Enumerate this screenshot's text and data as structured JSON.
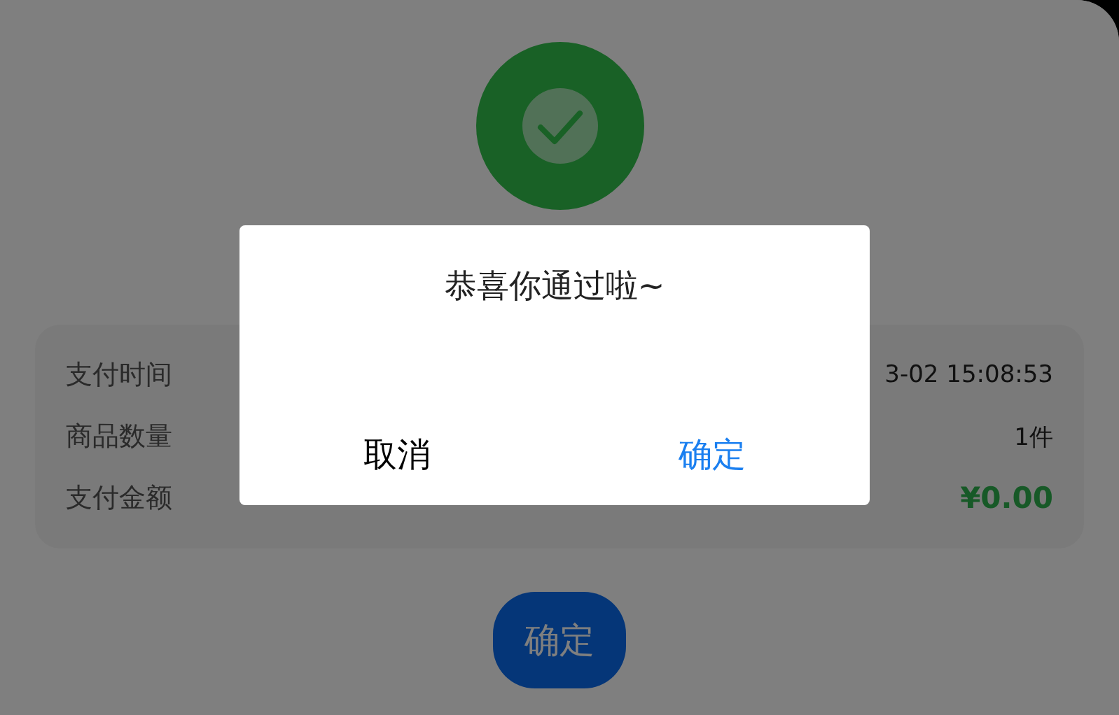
{
  "status": {
    "kind": "success"
  },
  "details": [
    {
      "label": "支付时间",
      "value": "3-02 15:08:53",
      "kind": "text"
    },
    {
      "label": "商品数量",
      "value": "1件",
      "kind": "text"
    },
    {
      "label": "支付金额",
      "value": "¥0.00",
      "kind": "price"
    }
  ],
  "confirm_button": "确定",
  "dialog": {
    "message": "恭喜你通过啦~",
    "buttons": [
      {
        "label": "取消",
        "kind": "cancel"
      },
      {
        "label": "确定",
        "kind": "confirm"
      }
    ]
  }
}
